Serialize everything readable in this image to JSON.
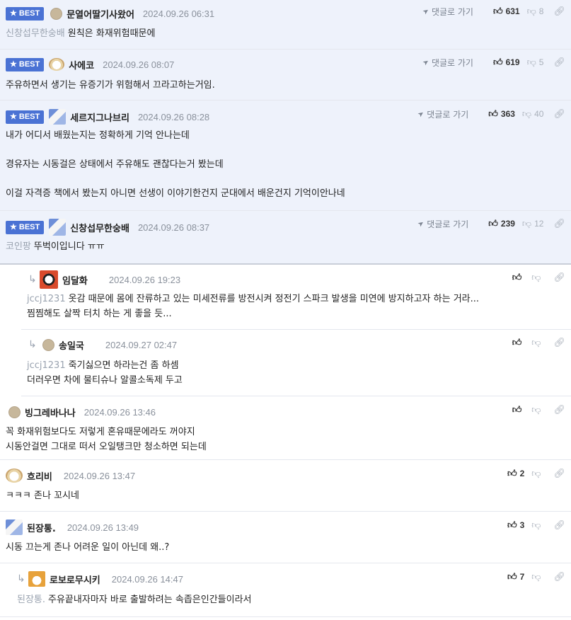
{
  "best_label": "BEST",
  "goto_label": "댓글로 가기",
  "comments": [
    {
      "nick": "문열어딸기사왔어",
      "time": "2024.09.26 06:31",
      "up": "631",
      "down": "8",
      "mention": "신창섭무한숭배",
      "text": [
        "원칙은 화재위험때문에"
      ]
    },
    {
      "nick": "사에코",
      "time": "2024.09.26 08:07",
      "up": "619",
      "down": "5",
      "mention": "",
      "text": [
        "주유하면서 생기는 유증기가 위험해서 끄라고하는거임."
      ]
    },
    {
      "nick": "세르지그나브리",
      "time": "2024.09.26 08:28",
      "up": "363",
      "down": "40",
      "mention": "",
      "text": [
        "내가 어디서 배웠는지는 정확하게 기억 안나는데",
        "경유자는 시동걸은 상태에서 주유해도 괜찮다는거 봤는데",
        "이걸 자격증 책에서 봤는지 아니면 선생이 이야기한건지 군대에서 배운건지 기억이안나네"
      ]
    },
    {
      "nick": "신창섭무한숭배",
      "time": "2024.09.26 08:37",
      "up": "239",
      "down": "12",
      "mention": "코인팡",
      "text": [
        "뚜벅이입니다 ㅠㅠ"
      ]
    },
    {
      "nick": "임달화",
      "time": "2024.09.26 19:23",
      "up": "",
      "down": "",
      "mention": "jccj1231",
      "text": [
        "옷감 때문에 몸에 잔류하고 있는 미세전류를 방전시켜 정전기 스파크 발생을 미연에 방지하고자 하는 거라...",
        "찜찜해도 살짝 터치 하는 게 좋을 듯..."
      ]
    },
    {
      "nick": "송일국",
      "time": "2024.09.27 02:47",
      "up": "",
      "down": "",
      "mention": "jccj1231",
      "text": [
        "죽기싫으면 하라는건 좀 하셈",
        "더러우면 차에 물티슈나 알콜소독제 두고"
      ]
    },
    {
      "nick": "빙그레바나나",
      "time": "2024.09.26 13:46",
      "up": "",
      "down": "",
      "mention": "",
      "text": [
        "꼭 화재위험보다도 저렇게 혼유때문에라도 꺼야지",
        "시동안걸면 그대로 떠서 오일탱크만 청소하면 되는데"
      ]
    },
    {
      "nick": "흐리비",
      "time": "2024.09.26 13:47",
      "up": "2",
      "down": "",
      "mention": "",
      "text": [
        "ㅋㅋㅋ 존나 꼬시네"
      ]
    },
    {
      "nick": "된장통.",
      "time": "2024.09.26 13:49",
      "up": "3",
      "down": "",
      "mention": "",
      "text": [
        "시동 끄는게 존나 어려운 일이 아닌데 왜..?"
      ]
    },
    {
      "nick": "로보로무시키",
      "time": "2024.09.26 14:47",
      "up": "7",
      "down": "",
      "mention": "된장통.",
      "text": [
        "주유끝내자마자 바로 출발하려는 속좁은인간들이라서"
      ]
    }
  ]
}
